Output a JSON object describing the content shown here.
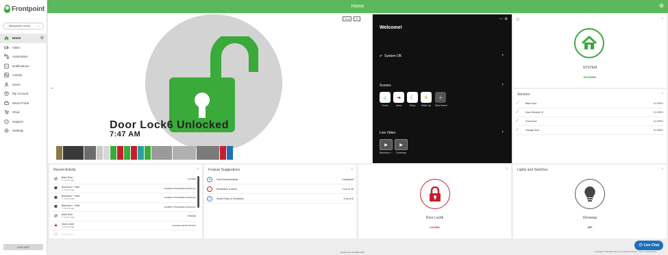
{
  "header": {
    "title": "Home"
  },
  "logo": {
    "brand": "Frontpoint"
  },
  "home_select": {
    "value": "Blackwell's Home"
  },
  "nav": [
    {
      "label": "Home",
      "icon": "home-icon",
      "active": true
    },
    {
      "label": "Video",
      "icon": "video-icon"
    },
    {
      "label": "Automation",
      "icon": "automation-icon"
    },
    {
      "label": "Notifications",
      "icon": "notification-icon"
    },
    {
      "label": "Activity",
      "icon": "activity-icon"
    },
    {
      "label": "Users",
      "icon": "users-icon"
    },
    {
      "label": "My Account",
      "icon": "account-icon"
    },
    {
      "label": "Move Portal",
      "icon": "move-icon"
    },
    {
      "label": "Shop",
      "icon": "cart-icon"
    },
    {
      "label": "Support",
      "icon": "support-icon"
    },
    {
      "label": "Settings",
      "icon": "settings-icon"
    }
  ],
  "sidebar": {
    "logout": "LOG OUT"
  },
  "camera": {
    "title": "Door Lock6 Unlocked",
    "time": "7:47 AM",
    "control": "1x",
    "colors": {
      "lock": "#3aaa3a",
      "circle": "#d3d3d3"
    }
  },
  "welcome": {
    "title": "Welcome!",
    "system": "System OK",
    "scenes_label": "Scenes",
    "scenes": [
      {
        "label": "Home",
        "color": "#3aaa3a"
      },
      {
        "label": "Away",
        "color": "#c41e2e"
      },
      {
        "label": "Sleep",
        "color": "#1f6fb8"
      },
      {
        "label": "Wake Up",
        "color": "#f0a500"
      },
      {
        "label": "New Scene",
        "color": "#555555"
      }
    ],
    "video_label": "Live Video",
    "videos": [
      {
        "label": "Backdoor +..."
      },
      {
        "label": "Driveway"
      }
    ]
  },
  "system": {
    "label": "SYSTEM",
    "status": "DISARMED"
  },
  "sensors": {
    "title": "Sensors",
    "rows": [
      {
        "name": "Back Door",
        "status": "CLOSED"
      },
      {
        "name": "Door Window 10",
        "status": "CLOSED"
      },
      {
        "name": "Front Door",
        "status": "CLOSED"
      },
      {
        "name": "Garage Door",
        "status": "CLOSED"
      }
    ]
  },
  "recent": {
    "title": "Recent Activity",
    "rows": [
      {
        "icon": "door-icon",
        "name": "Back Door",
        "time": "2 hours ago",
        "status": "CLOSED"
      },
      {
        "icon": "camera-icon",
        "name": "Backdoor + Gate",
        "time": "2 hours ago",
        "status": "CAMERA TRIGGERED (MANUAL)"
      },
      {
        "icon": "camera-icon",
        "name": "Backdoor + Gate",
        "time": "2 hours ago",
        "status": "CAMERA TRIGGERED (MANUAL)"
      },
      {
        "icon": "camera-icon",
        "name": "Backdoor + Gate",
        "time": "2 hours ago",
        "status": "CAMERA TRIGGERED (MANUAL)"
      },
      {
        "icon": "door-icon",
        "name": "Back Door",
        "time": "2 hours ago",
        "status": "OPENED"
      },
      {
        "icon": "lock-icon",
        "name": "Door Lock6",
        "time": "4 hours ago",
        "status": "LOCKED FROM KEYPAD"
      },
      {
        "icon": "door-icon",
        "name": "Front Door",
        "time": "",
        "status": ""
      }
    ]
  },
  "suggest": {
    "title": "Feature Suggestions",
    "rows": [
      {
        "name": "First Enhancements",
        "status": "Completed"
      },
      {
        "name": "Reminders & Alerts",
        "status": "2 out of 10"
      },
      {
        "name": "Smart Rules & Schedules",
        "status": "3 out of 6"
      }
    ]
  },
  "lock": {
    "name": "Door Lock6",
    "status": "LOCKED"
  },
  "lights": {
    "title": "Lights and Switches",
    "name": "Driveway",
    "status": "OFF"
  },
  "footer": {
    "powered": "powered by ALARM.COM",
    "copyright": "Copyright © 2000-2024 Alarm.com. All rights reserved.",
    "terms": "Terms",
    "privacy": "Privacy Policy"
  },
  "livechat": {
    "label": "Live Chat"
  },
  "colors": {
    "brand_green": "#5cb85c",
    "ok_green": "#3aaa3a",
    "alert_red": "#c41e2e",
    "chat_blue": "#1f6fb8"
  }
}
